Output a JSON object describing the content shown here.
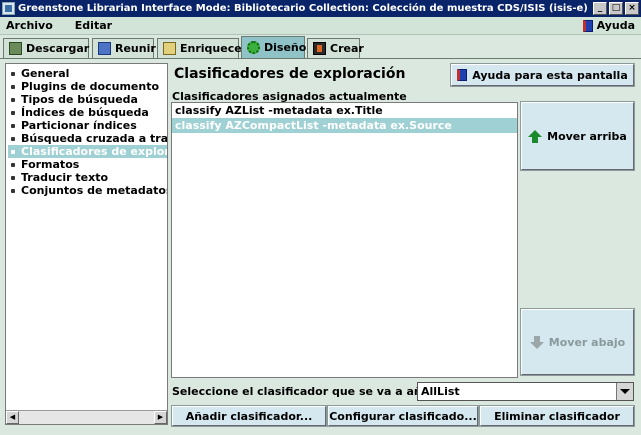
{
  "window": {
    "title": "Greenstone Librarian Interface  Mode: Bibliotecario  Collection: Colección de muestra CDS/ISIS (isis-e)",
    "controls": [
      "_",
      "□",
      "×"
    ]
  },
  "menubar": {
    "items": [
      "Archivo",
      "Editar"
    ],
    "help": "Ayuda"
  },
  "tabs": [
    {
      "label": "Descargar",
      "icon": "download-icon"
    },
    {
      "label": "Reunir",
      "icon": "gather-icon"
    },
    {
      "label": "Enriquecer",
      "icon": "enrich-icon"
    },
    {
      "label": "Diseño",
      "icon": "gear-icon"
    },
    {
      "label": "Crear",
      "icon": "create-icon"
    }
  ],
  "active_tab": "Diseño",
  "sidebar": {
    "items": [
      "General",
      "Plugins de documento",
      "Tipos de búsqueda",
      "Índices de búsqueda",
      "Particionar índices",
      "Búsqueda cruzada a través",
      "Clasificadores de exploración",
      "Formatos",
      "Traducir texto",
      "Conjuntos de metadatos"
    ],
    "selected_index": 6,
    "scroll_left": "◀",
    "scroll_right": "▶"
  },
  "main": {
    "title": "Clasificadores de exploración",
    "help_button": "Ayuda para esta pantalla",
    "list_label": "Clasificadores asignados actualmente",
    "classifiers": [
      "classify AZList -metadata ex.Title",
      "classify AZCompactList -metadata ex.Source"
    ],
    "selected_index": 1,
    "move_up": "Mover arriba",
    "move_down": "Mover abajo",
    "select_label": "Seleccione el clasificador que se va a añadir:",
    "select_value": "AllList",
    "add_button": "Añadir clasificador...",
    "configure_button": "Configurar clasificado...",
    "remove_button": "Eliminar clasificador"
  },
  "colors": {
    "titlebar": "#0a246a",
    "selection": "#9fd0d4",
    "background": "#dbe8e0"
  }
}
